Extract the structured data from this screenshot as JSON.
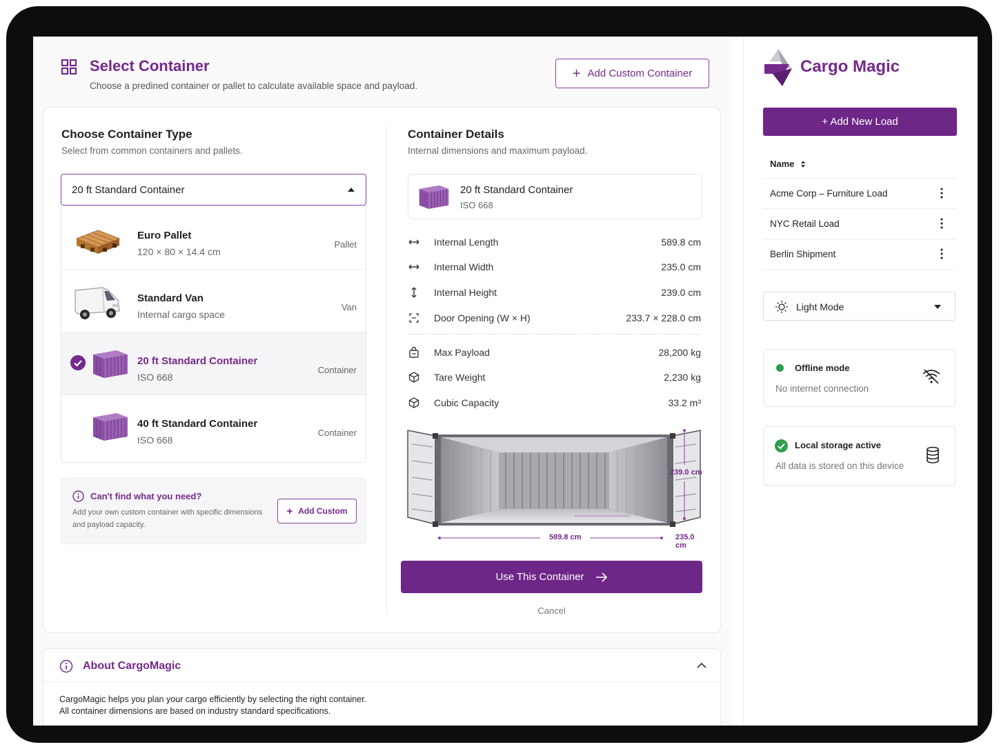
{
  "header": {
    "title": "Select Container",
    "subtitle": "Choose a predined container or pallet to calculate available space and payload.",
    "add_custom_label": "Add Custom Container"
  },
  "choose": {
    "title": "Choose Container Type",
    "subtitle": "Select from common containers and pallets.",
    "selected_value": "20 ft Standard Container",
    "items": [
      {
        "name": "Euro Pallet",
        "desc": "120 × 80 × 14.4 cm",
        "tag": "Pallet",
        "icon": "pallet-icon"
      },
      {
        "name": "Standard Van",
        "desc": "Internal cargo space",
        "tag": "Van",
        "icon": "van-icon"
      },
      {
        "name": "20 ft Standard Container",
        "desc": "ISO 668",
        "tag": "Container",
        "icon": "container-icon",
        "selected": true
      },
      {
        "name": "40 ft Standard Container",
        "desc": "ISO 668",
        "tag": "Container",
        "icon": "container-icon"
      }
    ],
    "help_title": "Can't find what you need?",
    "help_text": "Add your own custom container with specific dimensions and payload capacity.",
    "help_button": "Add Custom"
  },
  "details": {
    "title": "Container Details",
    "subtitle": "Internal dimensions and maximum payload.",
    "name": "20 ft Standard Container",
    "standard": "ISO 668",
    "rows": [
      {
        "label": "Internal Length",
        "value": "589.8 cm",
        "icon": "horizontal-arrows-icon"
      },
      {
        "label": "Internal Width",
        "value": "235.0 cm",
        "icon": "horizontal-arrows-icon"
      },
      {
        "label": "Internal Height",
        "value": "239.0 cm",
        "icon": "vertical-arrows-icon"
      },
      {
        "label": "Door Opening (W × H)",
        "value": "233.7 × 228.0 cm",
        "icon": "door-frame-icon"
      },
      {
        "label": "Max Payload",
        "value": "28,200 kg",
        "icon": "weight-icon"
      },
      {
        "label": "Tare Weight",
        "value": "2,230 kg",
        "icon": "cube-icon"
      },
      {
        "label": "Cubic Capacity",
        "value": "33.2 m³",
        "icon": "cube-icon"
      }
    ],
    "dim_length": "589.8 cm",
    "dim_width": "235.0 cm",
    "dim_height": "239.0 cm",
    "use_button": "Use This Container",
    "cancel": "Cancel"
  },
  "about": {
    "title": "About CargoMagic",
    "line1": "CargoMagic helps you plan your cargo efficiently by selecting the right container.",
    "line2": "All container dimensions are based on industry standard specifications."
  },
  "sidebar": {
    "brand": "Cargo Magic",
    "add_load": "+ Add New Load",
    "column": "Name",
    "loads": [
      "Acme Corp – Furniture Load",
      "NYC Retail Load",
      "Berlin Shipment"
    ],
    "theme": "Light Mode",
    "offline_title": "Offline mode",
    "offline_sub": "No internet connection",
    "storage_title": "Local storage active",
    "storage_sub": "All data is stored on this device"
  },
  "colors": {
    "accent": "#74298c",
    "primary_button": "#6e2687",
    "success": "#2e9e4f"
  }
}
